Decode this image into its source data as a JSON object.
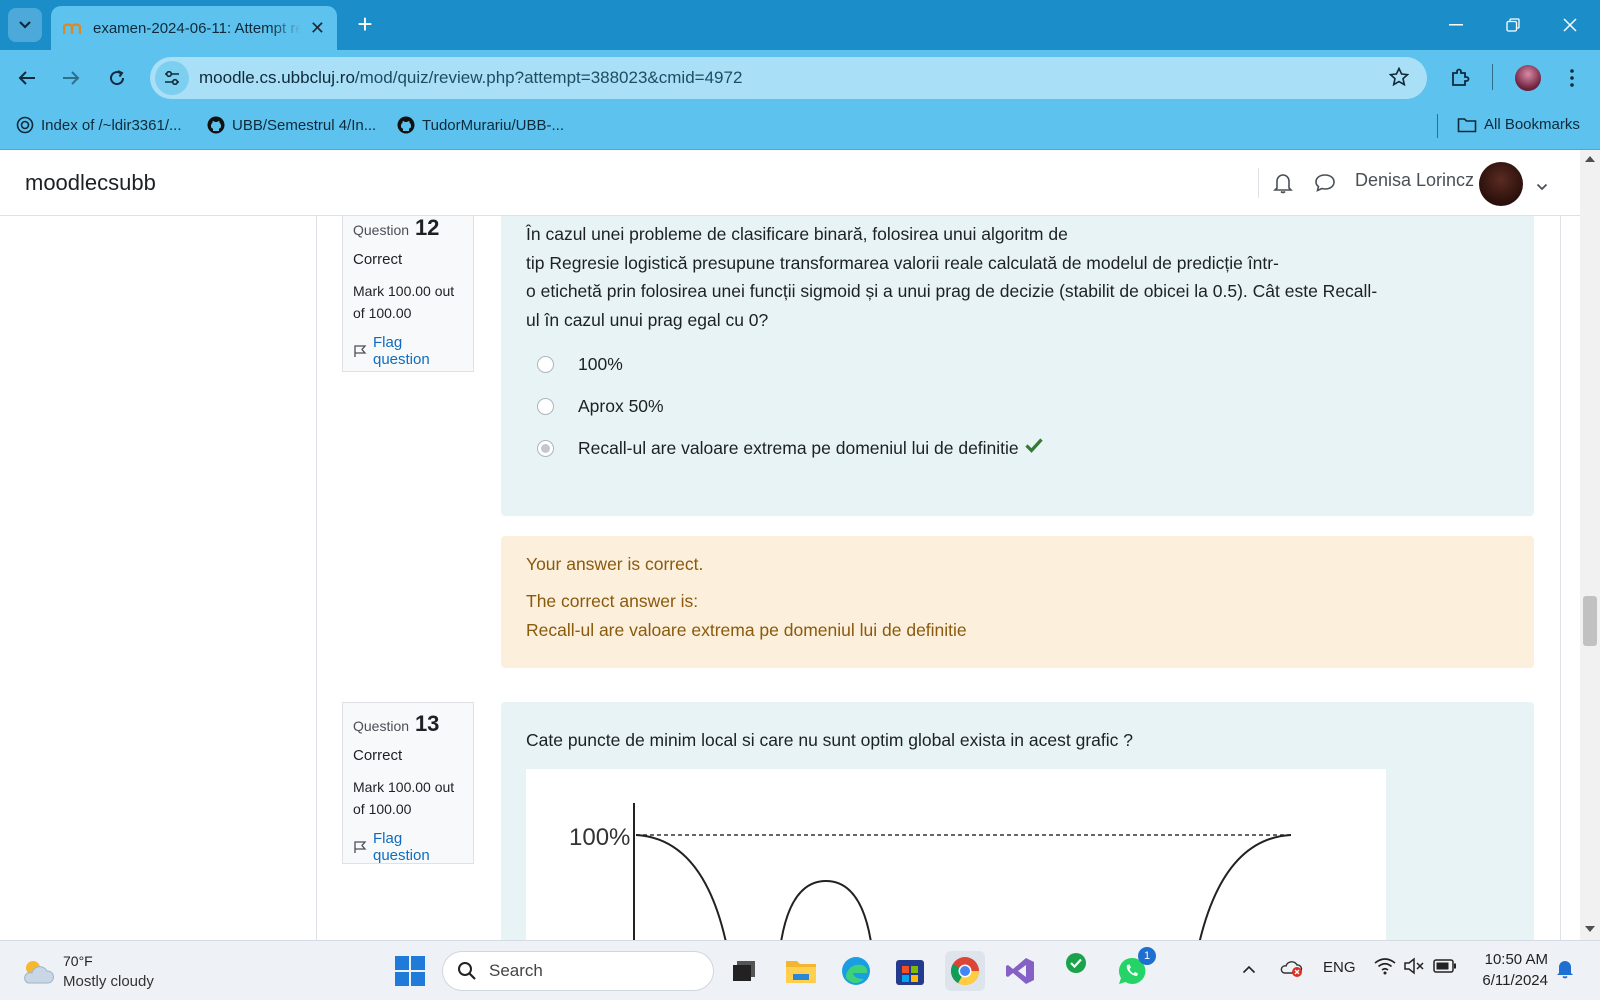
{
  "browser": {
    "tab_title": "examen-2024-06-11: Attempt review",
    "url_host": "moodle.cs.ubbcluj.ro",
    "url_path": "/mod/quiz/review.php?attempt=388023&cmid=4972",
    "bookmarks": [
      {
        "label": "Index of /~ldir3361/..."
      },
      {
        "label": "UBB/Semestrul 4/In..."
      },
      {
        "label": "TudorMurariu/UBB-..."
      }
    ],
    "all_bookmarks": "All Bookmarks"
  },
  "moodle": {
    "brand": "moodlecsubb",
    "user_name": "Denisa Lorincz"
  },
  "q12": {
    "label": "Question",
    "number": "12",
    "state": "Correct",
    "grade": "Mark 100.00 out of 100.00",
    "flag": "Flag question",
    "text_lines": [
      "În cazul unei probleme de clasificare binară, folosirea unui algoritm de",
      "tip Regresie logistică presupune transformarea valorii reale calculată de modelul de predicție într-",
      "o etichetă prin folosirea unei funcții sigmoid și a unui prag de decizie (stabilit de obicei la 0.5). Cât este Recall-",
      "ul în cazul unui prag egal cu 0?"
    ],
    "answers": [
      {
        "label": "100%",
        "selected": false
      },
      {
        "label": "Aprox 50%",
        "selected": false
      },
      {
        "label": "Recall-ul are valoare extrema pe domeniul lui de definitie",
        "selected": true,
        "correct": true
      }
    ],
    "feedback": "Your answer is correct.",
    "right_answer_label": "The correct answer is:",
    "right_answer": "Recall-ul are valoare extrema pe domeniul lui de definitie"
  },
  "q13": {
    "label": "Question",
    "number": "13",
    "state": "Correct",
    "grade": "Mark 100.00 out of 100.00",
    "flag": "Flag question",
    "text": "Cate puncte de minim local si care nu sunt optim global exista in acest grafic ?",
    "graph_label": "100%"
  },
  "taskbar": {
    "temperature": "70°F",
    "weather": "Mostly cloudy",
    "search_placeholder": "Search",
    "whatsapp_badge": "1",
    "language": "ENG",
    "time": "10:50 AM",
    "date": "6/11/2024"
  },
  "colors": {
    "tabstrip": "#1b8ec9",
    "toolbar": "#5ec2ee",
    "formulation_bg": "#e7f3f5",
    "outcome_bg": "#fcefdc",
    "link": "#0f6cbf",
    "check": "#357a32"
  }
}
